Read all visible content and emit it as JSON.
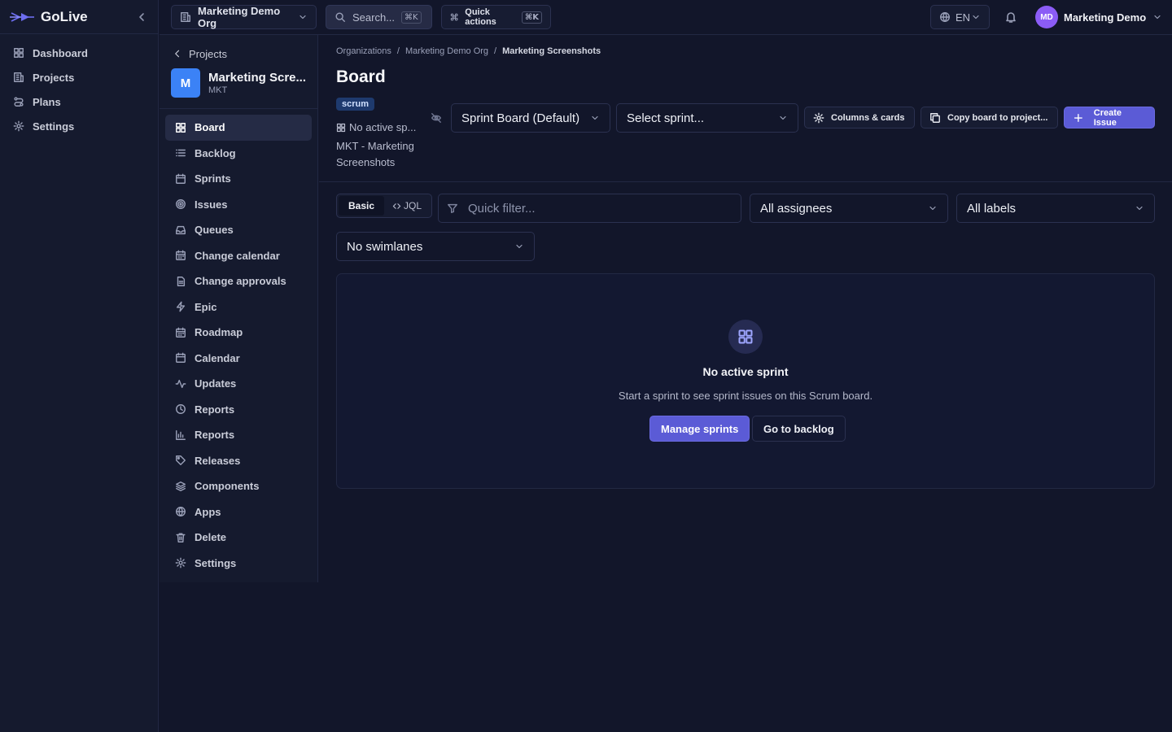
{
  "app": {
    "brand": "GoLive",
    "nav": [
      {
        "label": "Dashboard",
        "icon": "grid-icon"
      },
      {
        "label": "Projects",
        "icon": "building-icon"
      },
      {
        "label": "Plans",
        "icon": "route-icon"
      },
      {
        "label": "Settings",
        "icon": "gear-icon"
      }
    ]
  },
  "topbar": {
    "org": "Marketing Demo Org",
    "search_label": "Search...",
    "search_kbd": "⌘K",
    "quick_actions": "Quick actions",
    "quick_kbd": "⌘K",
    "language": "EN",
    "user_initials": "MD",
    "user_name": "Marketing Demo"
  },
  "project": {
    "back_label": "Projects",
    "avatar_letter": "M",
    "name": "Marketing Scre...",
    "key": "MKT",
    "nav": [
      {
        "label": "Board",
        "icon": "board-icon",
        "active": true
      },
      {
        "label": "Backlog",
        "icon": "list-icon"
      },
      {
        "label": "Sprints",
        "icon": "calendar-icon"
      },
      {
        "label": "Issues",
        "icon": "target-icon"
      },
      {
        "label": "Queues",
        "icon": "inbox-icon"
      },
      {
        "label": "Change calendar",
        "icon": "calendar-icon"
      },
      {
        "label": "Change approvals",
        "icon": "file-check-icon"
      },
      {
        "label": "Epic",
        "icon": "bolt-icon"
      },
      {
        "label": "Roadmap",
        "icon": "calendar-icon"
      },
      {
        "label": "Calendar",
        "icon": "calendar-icon"
      },
      {
        "label": "Updates",
        "icon": "activity-icon"
      },
      {
        "label": "Reports",
        "icon": "clock-icon"
      },
      {
        "label": "Reports",
        "icon": "bar-chart-icon"
      },
      {
        "label": "Releases",
        "icon": "tag-icon"
      },
      {
        "label": "Components",
        "icon": "layers-icon"
      },
      {
        "label": "Apps",
        "icon": "globe-icon"
      },
      {
        "label": "Delete",
        "icon": "trash-icon"
      },
      {
        "label": "Settings",
        "icon": "gear-icon"
      }
    ]
  },
  "main": {
    "breadcrumb": [
      "Organizations",
      "Marketing Demo Org",
      "Marketing Screenshots"
    ],
    "title": "Board",
    "tag": "scrum",
    "meta_sprint": "No active sp...",
    "meta_project": "MKT - Marketing Screenshots",
    "board_select": "Sprint Board (Default)",
    "sprint_select": "Select sprint...",
    "columns_btn": "Columns & cards",
    "copy_btn": "Copy board to project...",
    "create_btn": "Create Issue",
    "mode_basic": "Basic",
    "mode_jql": "JQL",
    "filter_placeholder": "Quick filter...",
    "assignees": "All assignees",
    "labels": "All labels",
    "swimlanes": "No swimlanes",
    "empty": {
      "title": "No active sprint",
      "desc": "Start a sprint to see sprint issues on this Scrum board.",
      "manage": "Manage sprints",
      "backlog": "Go to backlog"
    }
  },
  "colors": {
    "accent": "#5b5bd6",
    "background": "#12162a",
    "sidebar": "#151a2e",
    "project_avatar": "#3b82f6",
    "user_avatar": "#8b5cf6"
  }
}
